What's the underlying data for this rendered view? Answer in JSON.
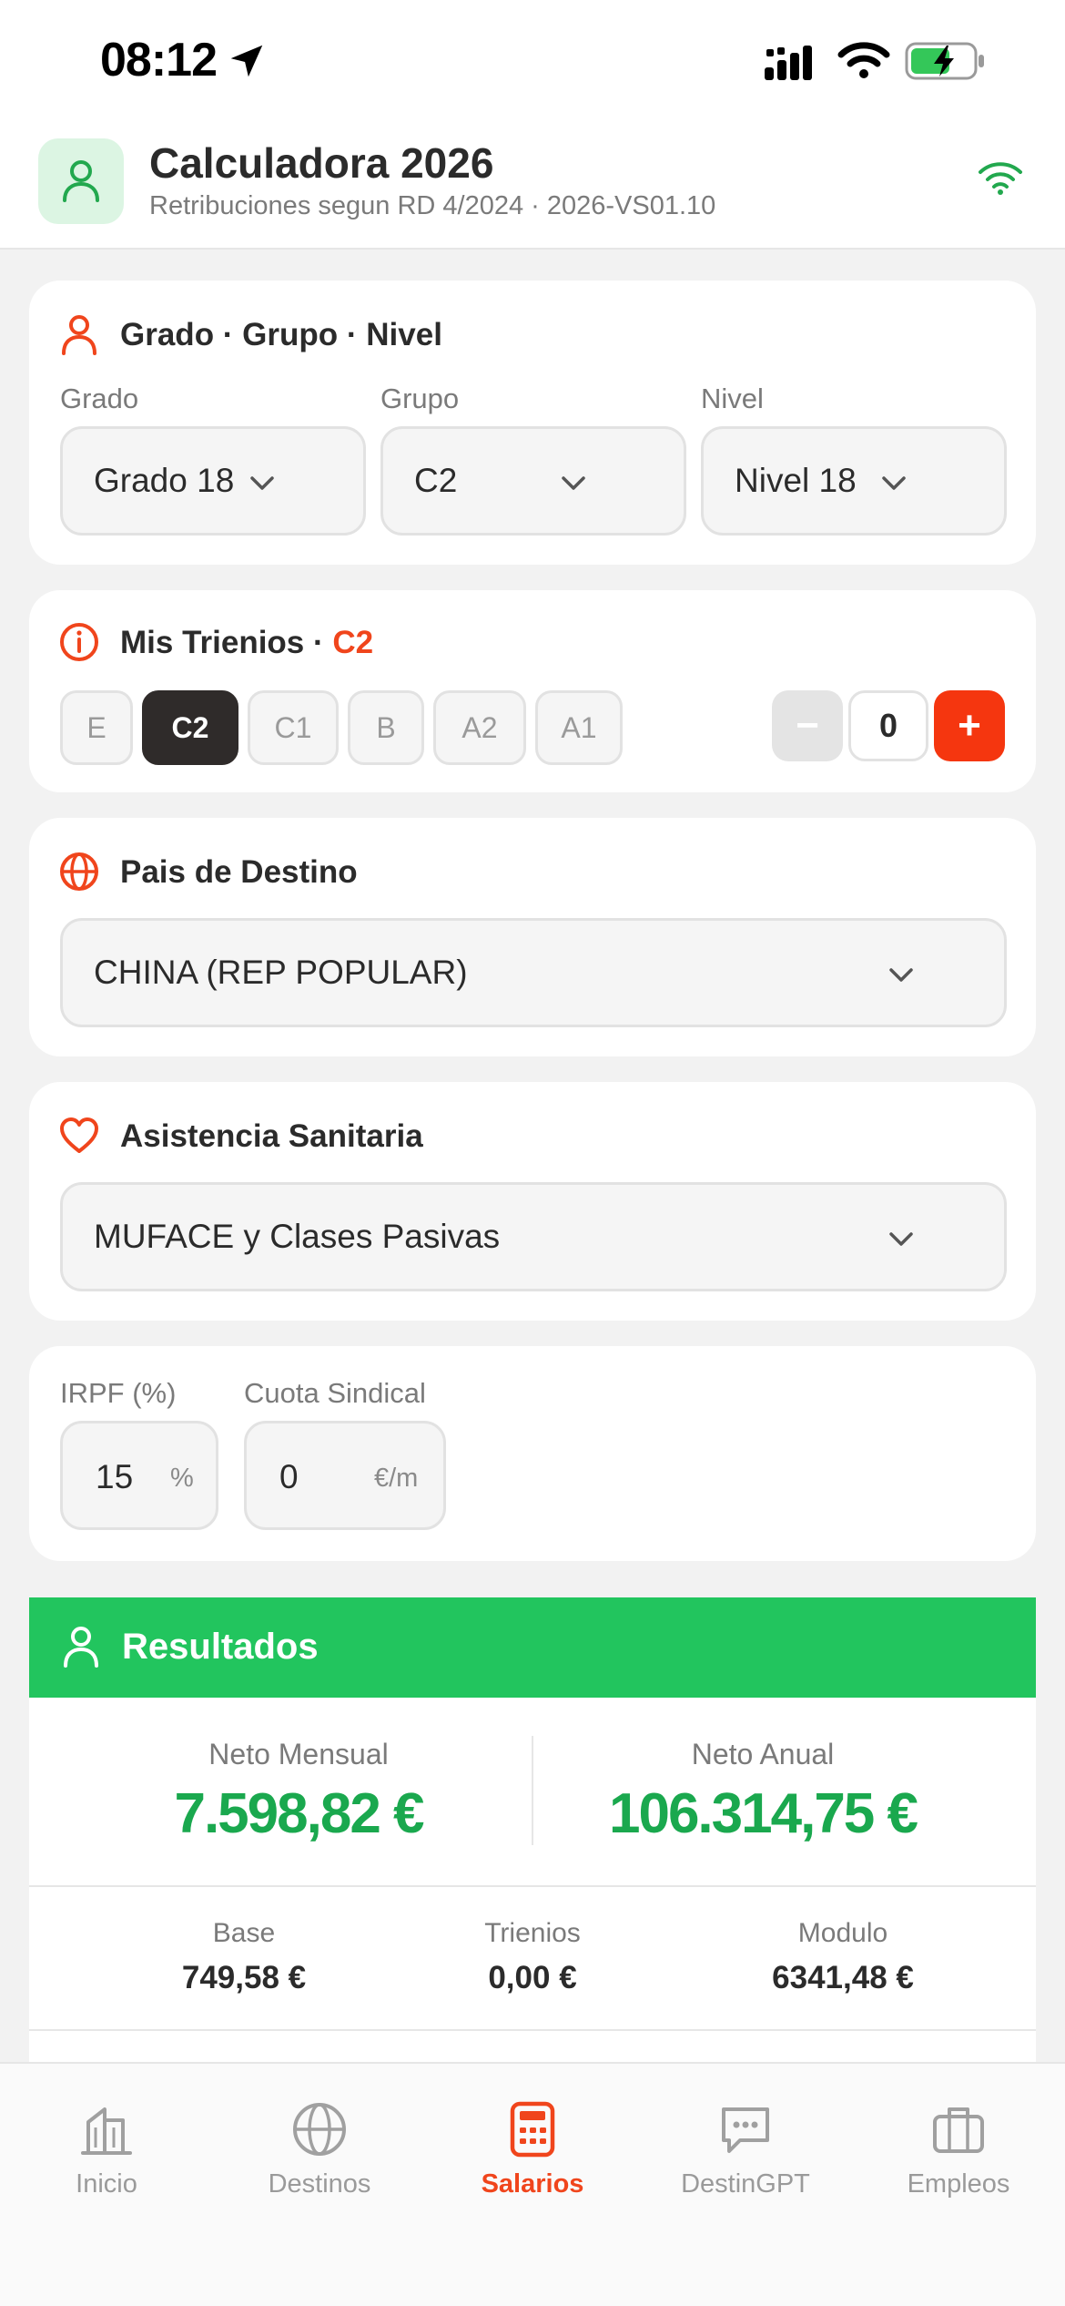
{
  "status_bar": {
    "time": "08:12"
  },
  "header": {
    "title": "Calculadora 2026",
    "subtitle": "Retribuciones segun RD 4/2024 · 2026-VS01.10",
    "avatar_icon": "user-icon",
    "status_icon": "wifi-icon"
  },
  "grado_card": {
    "title": "Grado · Grupo · Nivel",
    "grado_label": "Grado",
    "grupo_label": "Grupo",
    "nivel_label": "Nivel",
    "grado_value": "Grado 18",
    "grupo_value": "C2",
    "nivel_value": "Nivel 18"
  },
  "trienios_card": {
    "title": "Mis Trienios · ",
    "title_accent": "C2",
    "groups": [
      "E",
      "C2",
      "C1",
      "B",
      "A2",
      "A1"
    ],
    "selected_group": "C2",
    "minus_label": "−",
    "plus_label": "+",
    "count": "0"
  },
  "destino_card": {
    "title": "Pais de Destino",
    "value": "CHINA (REP POPULAR)"
  },
  "sanitaria_card": {
    "title": "Asistencia Sanitaria",
    "value": "MUFACE y Clases Pasivas"
  },
  "deducciones_card": {
    "irpf_label": "IRPF (%)",
    "irpf_value": "15",
    "irpf_unit": "%",
    "cuota_label": "Cuota Sindical",
    "cuota_value": "0",
    "cuota_unit": "€/m"
  },
  "results": {
    "title": "Resultados",
    "neto_mensual_label": "Neto Mensual",
    "neto_mensual_value": "7.598,82 €",
    "neto_anual_label": "Neto Anual",
    "neto_anual_value": "106.314,75 €",
    "base_label": "Base",
    "base_value": "749,58 €",
    "trienios_label": "Trienios",
    "trienios_value": "0,00 €",
    "modulo_label": "Modulo",
    "modulo_value": "6341,48 €"
  },
  "tab_bar": {
    "tabs": [
      {
        "label": "Inicio",
        "icon": "building-icon"
      },
      {
        "label": "Destinos",
        "icon": "globe-icon"
      },
      {
        "label": "Salarios",
        "icon": "calculator-icon"
      },
      {
        "label": "DestinGPT",
        "icon": "chat-icon"
      },
      {
        "label": "Empleos",
        "icon": "briefcase-icon"
      }
    ],
    "active": "Salarios"
  },
  "colors": {
    "accent": "#f0451c",
    "green": "#22c55e",
    "green_text": "#1aa84e",
    "chip_active": "#2f2b2a"
  }
}
